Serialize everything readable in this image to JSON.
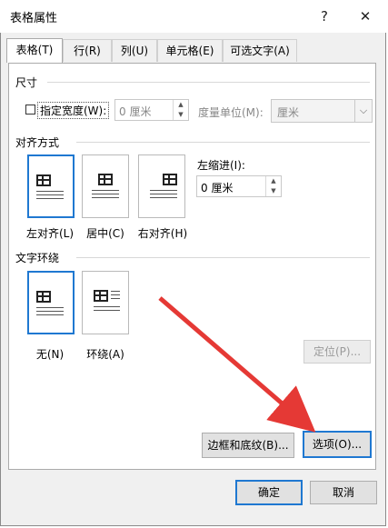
{
  "window": {
    "title": "表格属性",
    "help": "?",
    "close": "✕"
  },
  "tabs": [
    {
      "label": "表格(T)"
    },
    {
      "label": "行(R)"
    },
    {
      "label": "列(U)"
    },
    {
      "label": "单元格(E)"
    },
    {
      "label": "可选文字(A)"
    }
  ],
  "size": {
    "section": "尺寸",
    "specify_width_label": "指定宽度(W):",
    "width_value": "0 厘米",
    "unit_label": "度量单位(M):",
    "unit_value": "厘米"
  },
  "alignment": {
    "section": "对齐方式",
    "options": [
      {
        "label": "左对齐(L)"
      },
      {
        "label": "居中(C)"
      },
      {
        "label": "右对齐(H)"
      }
    ],
    "indent_label": "左缩进(I):",
    "indent_value": "0 厘米"
  },
  "wrapping": {
    "section": "文字环绕",
    "options": [
      {
        "label": "无(N)"
      },
      {
        "label": "环绕(A)"
      }
    ],
    "position_button": "定位(P)..."
  },
  "buttons": {
    "borders": "边框和底纹(B)...",
    "options": "选项(O)...",
    "ok": "确定",
    "cancel": "取消"
  },
  "arrow_color": "#e53935",
  "focus_color": "#1f78d1"
}
